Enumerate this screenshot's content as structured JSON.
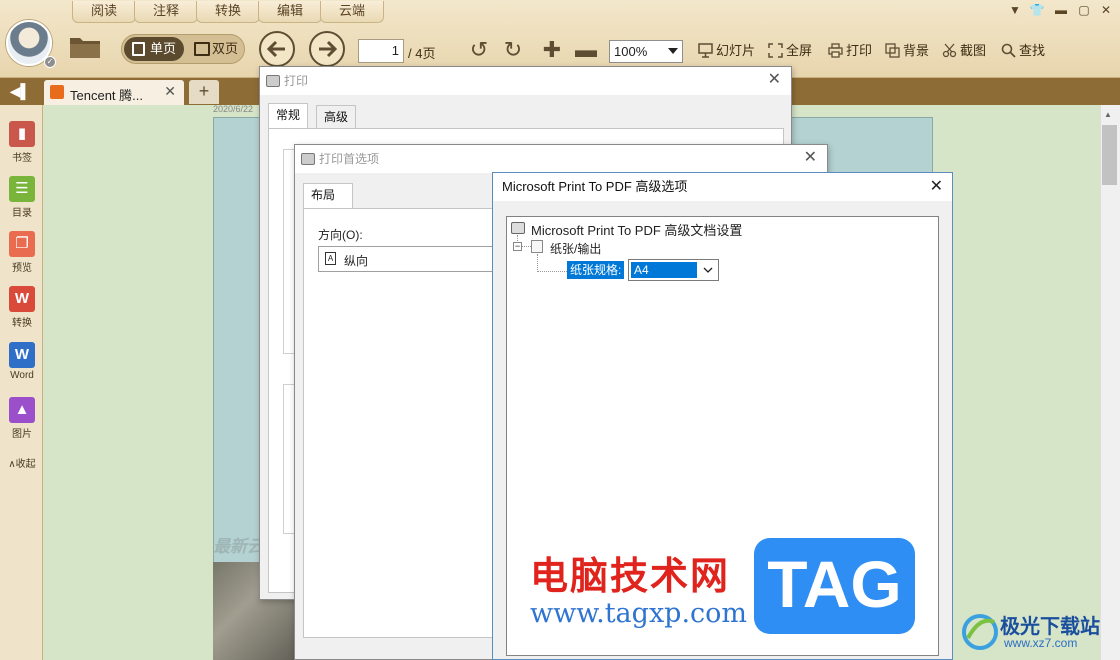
{
  "app": {
    "menu_tabs": [
      "阅读",
      "注释",
      "转换",
      "编辑",
      "云端"
    ],
    "view_single": "单页",
    "view_double": "双页",
    "page_current": "1",
    "page_total": "/ 4页",
    "zoom": "100%",
    "tools": [
      "幻灯片",
      "全屏",
      "打印",
      "背景",
      "截图",
      "查找"
    ]
  },
  "tabs": {
    "doc_title": "Tencent 腾...",
    "new_tab": "+"
  },
  "sidebar": {
    "items": [
      {
        "label": "书签",
        "icon": "bookmark-icon",
        "color": "#c9574b"
      },
      {
        "label": "目录",
        "icon": "toc-icon",
        "color": "#79b53b"
      },
      {
        "label": "预览",
        "icon": "preview-icon",
        "color": "#e96b50"
      },
      {
        "label": "转换",
        "icon": "pdf-convert-icon",
        "color": "#d94a3a"
      },
      {
        "label": "Word",
        "icon": "word-icon",
        "color": "#2f6fc7"
      },
      {
        "label": "图片",
        "icon": "image-icon",
        "color": "#9b4fcb"
      }
    ],
    "collapse_label": "∧收起"
  },
  "document": {
    "date_fragment": "2020/6/22",
    "text_fragment": "最新云"
  },
  "print_dialog": {
    "title": "打印",
    "tabs": [
      "常规",
      "高级"
    ]
  },
  "pref_dialog": {
    "title": "打印首选项",
    "tab": "布局",
    "orientation_label": "方向(O):",
    "orientation_value": "纵向"
  },
  "adv_dialog": {
    "title": "Microsoft Print To PDF 高级选项",
    "tree_root": "Microsoft Print To PDF 高级文档设置",
    "tree_node": "纸张/输出",
    "paper_size_label": "纸张规格:",
    "paper_size_value": "A4"
  },
  "watermark": {
    "site_name": "电脑技术网",
    "site_url": "www.tagxp.com",
    "tag": "TAG",
    "corner_brand": "极光下载站",
    "corner_url": "www.xz7.com"
  },
  "colors": {
    "accent_brown": "#8e6c35",
    "selection_blue": "#0078d7",
    "watermark_red": "#e0231d",
    "tag_blue": "#2f8ef3"
  }
}
